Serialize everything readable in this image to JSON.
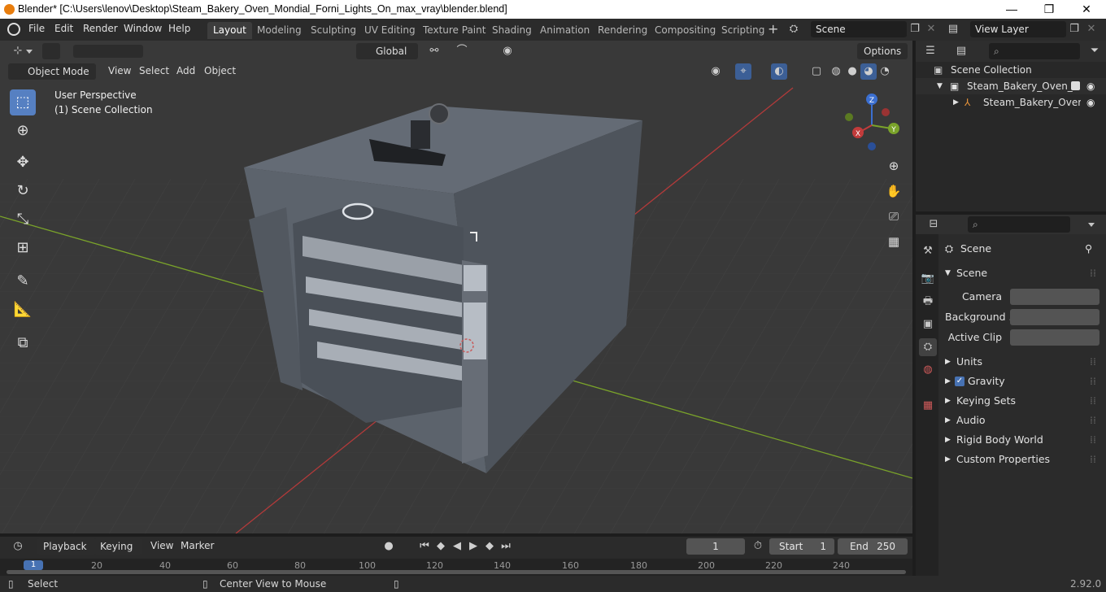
{
  "window": {
    "title": "Blender* [C:\\Users\\lenov\\Desktop\\Steam_Bakery_Oven_Mondial_Forni_Lights_On_max_vray\\blender.blend]",
    "minimize": "—",
    "maximize": "❐",
    "close": "✕"
  },
  "menus": [
    "File",
    "Edit",
    "Render",
    "Window",
    "Help"
  ],
  "workspaces": [
    "Layout",
    "Modeling",
    "Sculpting",
    "UV Editing",
    "Texture Paint",
    "Shading",
    "Animation",
    "Rendering",
    "Compositing",
    "Scripting"
  ],
  "active_workspace": "Layout",
  "scene_field": "Scene",
  "view_layer_field": "View Layer",
  "viewport_header": {
    "transform_orientation": "Global",
    "options": "Options",
    "mode": "Object Mode",
    "menus": [
      "View",
      "Select",
      "Add",
      "Object"
    ]
  },
  "viewport_info": {
    "line1": "User Perspective",
    "line2": "(1) Scene Collection"
  },
  "gizmo_axes": {
    "x": "X",
    "y": "Y",
    "z": "Z"
  },
  "outliner": {
    "root": "Scene Collection",
    "collection": "Steam_Bakery_Oven_Mc",
    "object": "Steam_Bakery_Over"
  },
  "properties": {
    "header": "Scene",
    "panel": "Scene",
    "camera_label": "Camera",
    "background_label": "Background ...",
    "active_clip_label": "Active Clip",
    "sections": [
      "Units",
      "Gravity",
      "Keying Sets",
      "Audio",
      "Rigid Body World",
      "Custom Properties"
    ],
    "gravity_checked": true
  },
  "timeline": {
    "menus": [
      "Playback",
      "Keying",
      "View",
      "Marker"
    ],
    "current_frame": "1",
    "start_label": "Start",
    "start": "1",
    "end_label": "End",
    "end": "250",
    "ruler": [
      "1",
      "20",
      "40",
      "60",
      "80",
      "100",
      "120",
      "140",
      "160",
      "180",
      "200",
      "220",
      "240"
    ]
  },
  "statusbar": {
    "left": "Select",
    "middle": "Center View to Mouse",
    "version": "2.92.0"
  },
  "colors": {
    "accent": "#5680c2",
    "x_axis": "#c23b3b",
    "y_axis": "#7aa32a",
    "z_axis": "#3b6fd1",
    "oven_body": "#5f6670"
  }
}
